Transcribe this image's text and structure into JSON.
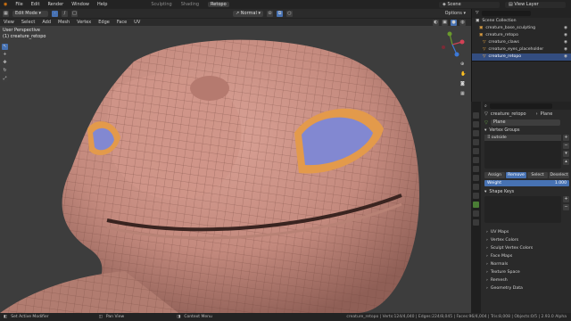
{
  "topbar": {
    "menus": [
      "File",
      "Edit",
      "Render",
      "Window",
      "Help"
    ],
    "workspaces": [
      {
        "label": "Sculpting",
        "active": false
      },
      {
        "label": "Shading",
        "active": false
      },
      {
        "label": "Retopo",
        "active": true
      }
    ],
    "scene": "Scene",
    "view_layer": "View Layer"
  },
  "viewport_header": {
    "mode": "Edit Mode",
    "orientation": "Normal",
    "options": "Options"
  },
  "viewport_menu": [
    "View",
    "Select",
    "Add",
    "Mesh",
    "Vertex",
    "Edge",
    "Face",
    "UV"
  ],
  "viewport": {
    "view_name": "User Perspective",
    "object_name": "(1) creature_retopo"
  },
  "outliner": {
    "items": [
      {
        "label": "Scene Collection",
        "selected": false
      },
      {
        "label": "creature_base_sculpting",
        "selected": false
      },
      {
        "label": "creature_retopo",
        "selected": false
      },
      {
        "label": "creature_claws",
        "selected": false
      },
      {
        "label": "creature_eyes_placeholder",
        "selected": false
      },
      {
        "label": "creature_retopo",
        "selected": true
      }
    ]
  },
  "properties": {
    "object": "creature_retopo",
    "data_type": "Plane",
    "mesh": "Plane",
    "vertex_groups_title": "Vertex Groups",
    "group_item": "outside",
    "buttons": [
      {
        "label": "Assign",
        "active": false
      },
      {
        "label": "Remove",
        "active": true
      },
      {
        "label": "Select",
        "active": false
      },
      {
        "label": "Deselect",
        "active": false
      }
    ],
    "weight_label": "Weight",
    "weight_value": "1.000",
    "shape_keys_title": "Shape Keys",
    "collapsed_panels": [
      "UV Maps",
      "Vertex Colors",
      "Sculpt Vertex Colors",
      "Face Maps",
      "Normals",
      "Texture Space",
      "Remesh",
      "Geometry Data"
    ]
  },
  "statusbar": {
    "left1": "Set Active Modifier",
    "left2": "Pan View",
    "left3": "Context Menu",
    "right": "creature_retopo | Verts:124/4,040 | Edges:224/8,045 | Faces:96/4,004 | Tris:8,008 | Objects:0/5 | 2.93.0 Alpha"
  },
  "colors": {
    "accent": "#4772b3",
    "mesh": "#c48a7e",
    "eye_rim": "#e39a4b",
    "eye": "#8288d1"
  }
}
